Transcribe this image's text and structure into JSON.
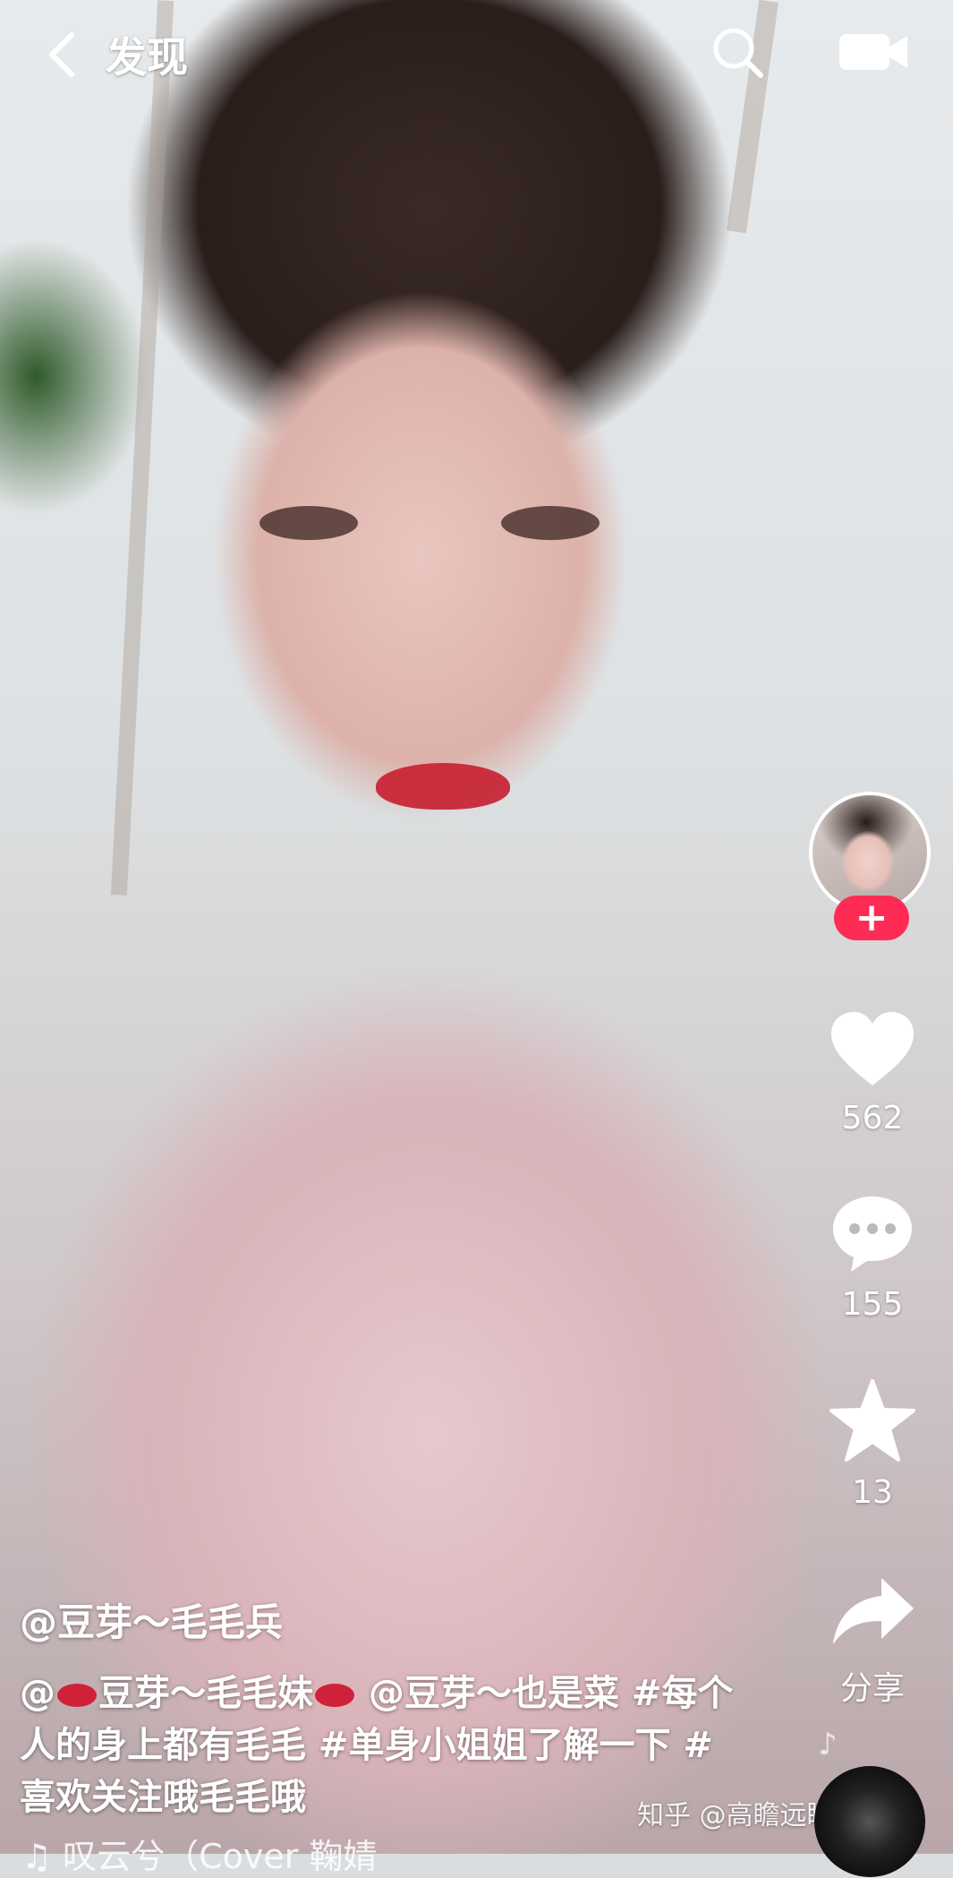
{
  "header": {
    "back_label": "发现"
  },
  "video": {
    "author_handle": "@豆芽～毛毛兵",
    "caption_part1": "@",
    "caption_part2": "豆芽～毛毛妹",
    "caption_part3": " @豆芽～也是菜 #每个人的身上都有毛毛 #单身小姐姐了解一下 #喜欢关注哦毛毛哦",
    "music_text": "♫ 叹云兮（Cover 鞠婧"
  },
  "actions": {
    "follow_symbol": "+",
    "like_count": "562",
    "comment_count": "155",
    "favorite_count": "13",
    "share_label": "分享"
  },
  "watermark": "知乎 @高瞻远瞩万里路",
  "colors": {
    "accent_follow": "#fe2c55",
    "icon_white": "#ffffff"
  },
  "icons": {
    "back": "chevron-left-icon",
    "search": "search-icon",
    "camera": "camera-icon",
    "like": "heart-icon",
    "comment": "comment-bubble-icon",
    "favorite": "star-icon",
    "share": "share-arrow-icon"
  }
}
